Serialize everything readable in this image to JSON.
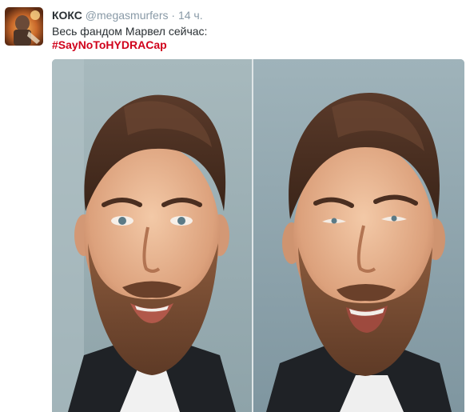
{
  "tweet": {
    "display_name": "КОКС",
    "handle": "@megasmurfers",
    "separator": "·",
    "time": "14 ч.",
    "text": "Весь фандом Марвел сейчас:",
    "hashtag": "#SayNoToHYDRACap"
  },
  "colors": {
    "hashtag": "#d0021b",
    "name": "#292f33",
    "meta": "#8899a6",
    "media_background": "#9fb2b8"
  },
  "icons": {
    "avatar": "user-avatar-photo",
    "media": "two-panel-face-photo"
  }
}
